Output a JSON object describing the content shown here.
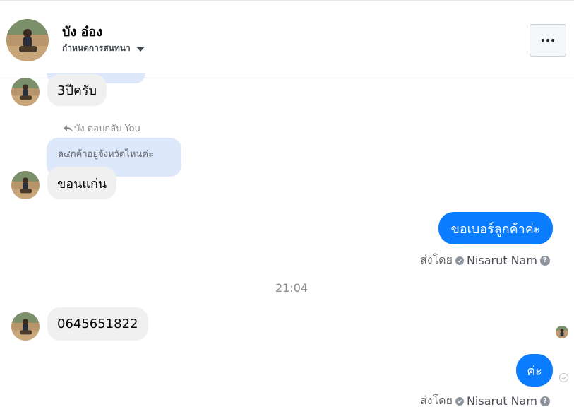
{
  "header": {
    "name": "บัง อ๋อง",
    "settings_label": "กำหนดการสนทนา",
    "avatar_icon": "profile-photo-icon",
    "more_icon": "more-options-icon"
  },
  "messages": [
    {
      "id": "m1",
      "direction": "incoming",
      "text": "3ปีครับ"
    },
    {
      "id": "m2",
      "direction": "incoming",
      "reply_note": "บัง ตอบกลับ You",
      "quoted_text": "ล๔กค้าอยู่จังหวัดไหนค่ะ",
      "text": "ขอนแก่น"
    },
    {
      "id": "m3",
      "direction": "outgoing",
      "text": "ขอเบอร์ลูกค้าค่ะ",
      "sent_by_label": "ส่งโดย",
      "sent_by_name": "Nisarut Nam"
    },
    {
      "id": "m4",
      "direction": "incoming",
      "text": "0645651822"
    },
    {
      "id": "m5",
      "direction": "outgoing",
      "text": "ค่ะ",
      "sent_by_label": "ส่งโดย",
      "sent_by_name": "Nisarut Nam"
    }
  ],
  "timestamp": "21:04",
  "colors": {
    "outgoing_bubble": "#0a7cff",
    "incoming_bubble": "#f0f0f0",
    "quote_bubble": "#dde8fb"
  }
}
